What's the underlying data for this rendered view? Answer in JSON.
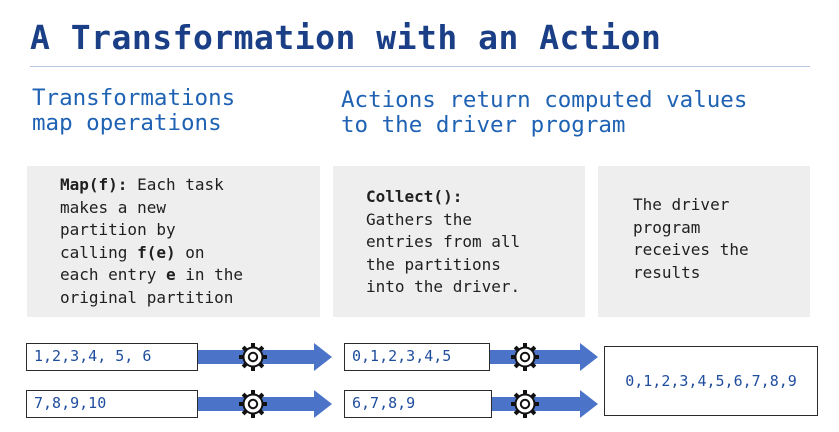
{
  "title": "A Transformation with an Action",
  "subtitles": {
    "transformations": [
      "Transformations",
      "map operations"
    ],
    "actions": [
      "Actions return computed values",
      "to the driver program"
    ]
  },
  "panels": {
    "map": {
      "lines": [
        {
          "bold": "Map(f):",
          "text": " Each task"
        },
        {
          "text": "makes a new"
        },
        {
          "text": "partition by"
        },
        {
          "text": "calling ",
          "bold": "f(e)",
          "after": " on"
        },
        {
          "text": "each entry ",
          "bold": "e",
          "after": " in the"
        },
        {
          "text": "original partition"
        }
      ]
    },
    "collect": {
      "lines": [
        {
          "bold": "Collect():"
        },
        {
          "text": "Gathers the"
        },
        {
          "text": "entries from all"
        },
        {
          "text": "the partitions"
        },
        {
          "text": "into the driver."
        }
      ]
    },
    "driver": {
      "lines": [
        {
          "text": "The driver"
        },
        {
          "text": "program"
        },
        {
          "text": "receives the"
        },
        {
          "text": "results"
        }
      ]
    }
  },
  "partitions": {
    "input": [
      "1,2,3,4, 5, 6",
      "7,8,9,10"
    ],
    "mapped": [
      "0,1,2,3,4,5",
      "6,7,8,9"
    ],
    "result": "0,1,2,3,4,5,6,7,8,9"
  },
  "icons": {
    "task": "gear-icon"
  },
  "colors": {
    "title": "#1a3f86",
    "subtitle": "#1f62b3",
    "arrow": "#4b74c9",
    "value": "#1f4d9e",
    "panel": "#eeeeee"
  }
}
